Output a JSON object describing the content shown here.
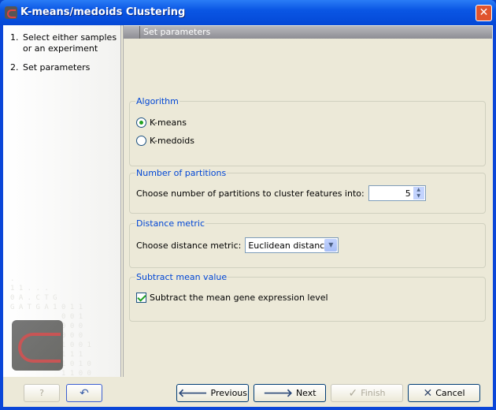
{
  "window": {
    "title": "K-means/medoids Clustering",
    "close_icon": "close-icon"
  },
  "steps": [
    {
      "num": "1.",
      "label": "Select either samples or an experiment"
    },
    {
      "num": "2.",
      "label": "Set parameters"
    }
  ],
  "header": {
    "title": "Set parameters"
  },
  "algorithm": {
    "legend": "Algorithm",
    "options": [
      {
        "label": "K-means",
        "selected": true
      },
      {
        "label": "K-medoids",
        "selected": false
      }
    ]
  },
  "partitions": {
    "legend": "Number of partitions",
    "label": "Choose number of partitions to cluster features into:",
    "value": "5"
  },
  "distance": {
    "legend": "Distance metric",
    "label": "Choose distance metric:",
    "value": "Euclidean distance"
  },
  "subtract": {
    "legend": "Subtract mean value",
    "label": "Subtract the mean gene expression level",
    "checked": true
  },
  "buttons": {
    "help": "?",
    "previous": "Previous",
    "next": "Next",
    "finish": "Finish",
    "cancel": "Cancel"
  },
  "colors": {
    "titlebar": "#0a56e4",
    "legend": "#0046d5",
    "panel": "#ece9d8"
  }
}
